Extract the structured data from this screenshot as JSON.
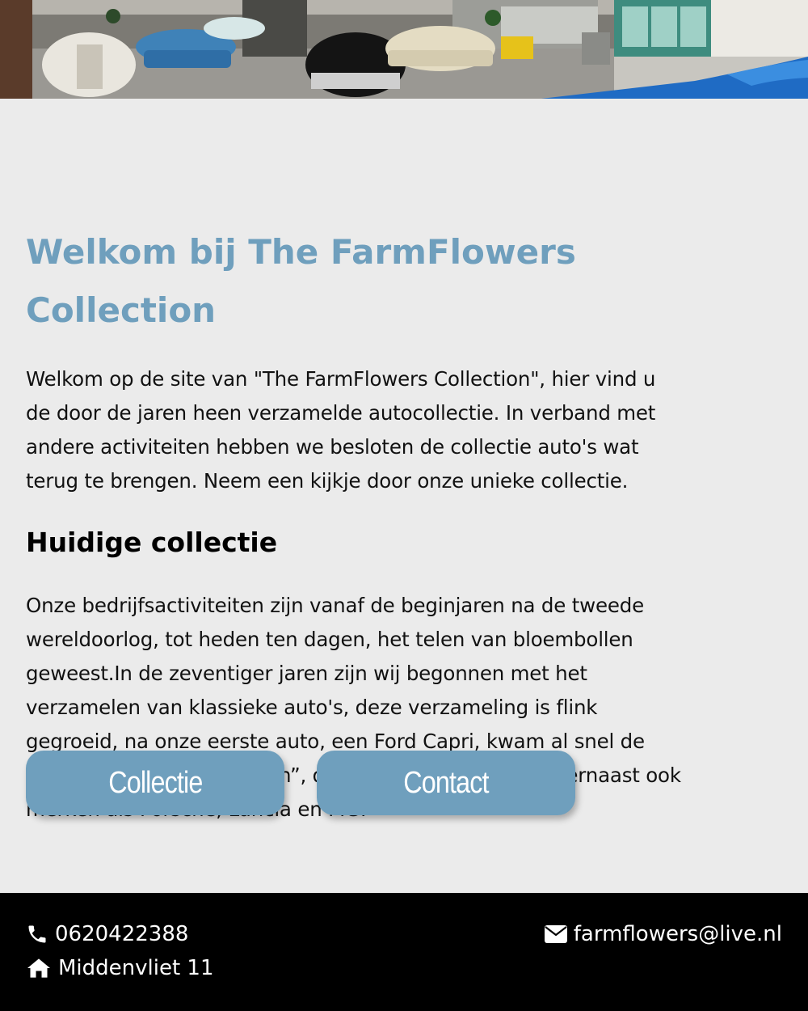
{
  "hero": {
    "alt": "Garage met klassieke auto's"
  },
  "intro": {
    "title_line1": "Welkom bij The FarmFlowers",
    "title_line2": "Collection",
    "lines": [
      "Welkom op de site van \"The FarmFlowers Collection\", hier vind u",
      "de door de jaren heen verzamelde autocollectie. In verband met",
      "andere activiteiten hebben we besloten de collectie auto's wat",
      "terug te brengen. Neem een kijkje door onze unieke collectie."
    ]
  },
  "collection": {
    "heading": "Huidige collectie",
    "lines": [
      "Onze bedrijfsactiviteiten zijn vanaf de beginjaren na de tweede",
      "wereldoorlog, tot heden ten dagen, het telen van bloembollen",
      "geweest.In de zeventiger jaren zijn wij begonnen met het",
      "verzamelen van klassieke auto's, deze verzameling is flink",
      "gegroeid, na onze eerste auto, een Ford Capri, kwam al snel de",
      "liefde voor de “Amerikanen”, desondanks hebben wij hiernaast ook",
      "merken als Porsche, Lancia en MG."
    ]
  },
  "buttons": {
    "collectie": "Collectie",
    "contact": "Contact"
  },
  "footer": {
    "phone": "0620422388",
    "address": "Middenvliet 11",
    "email": "farmflowers@live.nl"
  },
  "colors": {
    "accent": "#6f9fbd",
    "footer_bg": "#000000",
    "page_bg": "#ebebeb"
  },
  "icons": [
    "phone-icon",
    "home-icon",
    "envelope-icon"
  ]
}
